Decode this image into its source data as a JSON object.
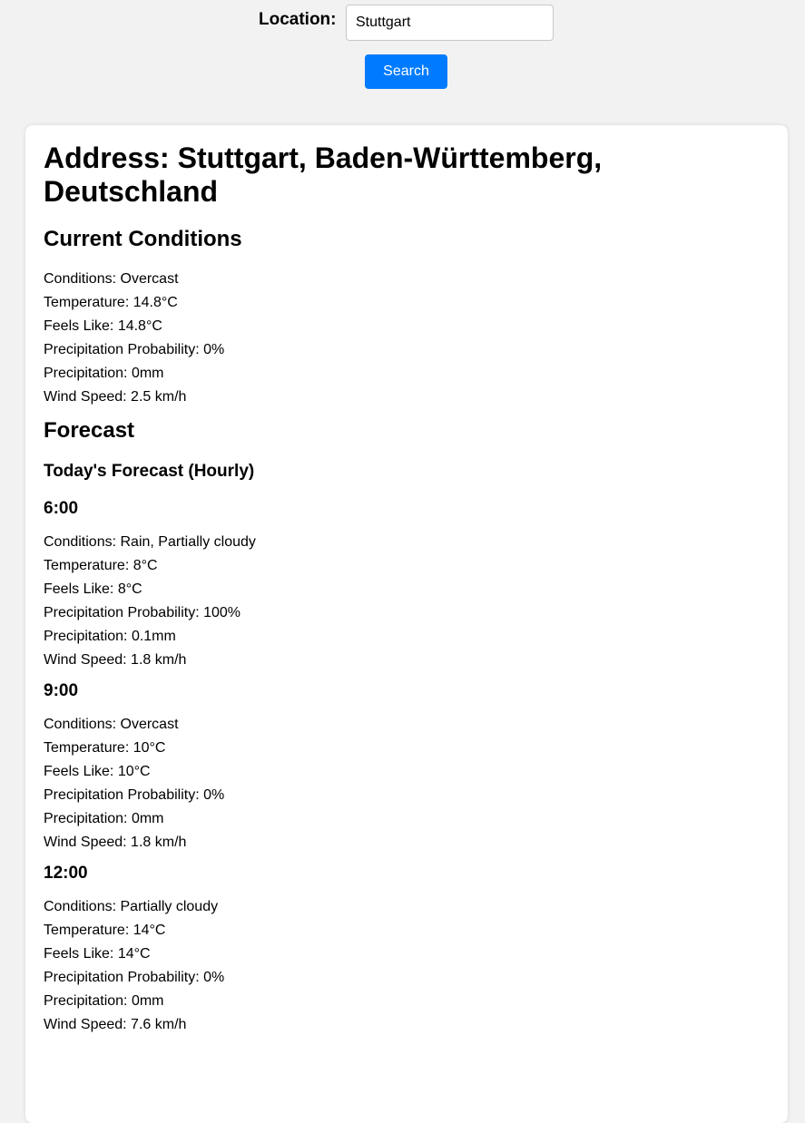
{
  "search": {
    "label": "Location:",
    "value": "Stuttgart",
    "button_label": "Search"
  },
  "result": {
    "address": "Address: Stuttgart, Baden-Württemberg, Deutschland",
    "current_heading": "Current Conditions",
    "current": [
      "Conditions: Overcast",
      "Temperature: 14.8°C",
      "Feels Like: 14.8°C",
      "Precipitation Probability: 0%",
      "Precipitation: 0mm",
      "Wind Speed: 2.5 km/h"
    ],
    "forecast_heading": "Forecast",
    "today_heading": "Today's Forecast (Hourly)",
    "hours": [
      {
        "time": "6:00",
        "rows": [
          "Conditions: Rain, Partially cloudy",
          "Temperature: 8°C",
          "Feels Like: 8°C",
          "Precipitation Probability: 100%",
          "Precipitation: 0.1mm",
          "Wind Speed: 1.8 km/h"
        ]
      },
      {
        "time": "9:00",
        "rows": [
          "Conditions: Overcast",
          "Temperature: 10°C",
          "Feels Like: 10°C",
          "Precipitation Probability: 0%",
          "Precipitation: 0mm",
          "Wind Speed: 1.8 km/h"
        ]
      },
      {
        "time": "12:00",
        "rows": [
          "Conditions: Partially cloudy",
          "Temperature: 14°C",
          "Feels Like: 14°C",
          "Precipitation Probability: 0%",
          "Precipitation: 0mm",
          "Wind Speed: 7.6 km/h"
        ]
      }
    ]
  },
  "colors": {
    "page_background": "#f2f2f2",
    "card_background": "#ffffff",
    "button_background": "#007bff",
    "button_text": "#ffffff"
  }
}
